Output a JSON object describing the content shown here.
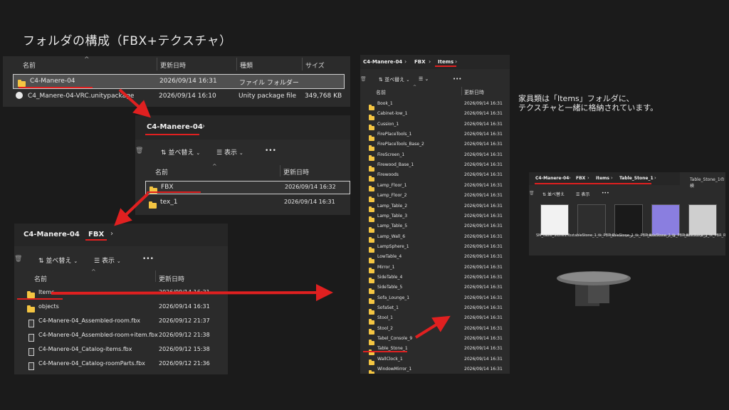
{
  "page_title": "フォルダの構成（FBX+テクスチャ）",
  "note": {
    "line1": "家具類は「Items」フォルダに、",
    "line2": "テクスチャと一緒に格納されています。"
  },
  "panel1": {
    "headers": [
      "名前",
      "更新日時",
      "種類",
      "サイズ"
    ],
    "rows": [
      {
        "name": "C4-Manere-04",
        "date": "2026/09/14 16:31",
        "type": "ファイル フォルダー",
        "size": "",
        "icon": "folder-icon"
      },
      {
        "name": "C4_Manere-04-VRC.unitypackage",
        "date": "2026/09/14 16:10",
        "type": "Unity package file",
        "size": "349,768 KB",
        "icon": "unity-icon"
      }
    ]
  },
  "panel2": {
    "breadcrumb": "C4-Manere-04",
    "sort_label": "並べ替え",
    "view_label": "表示",
    "more": "•••",
    "headers": [
      "名前",
      "更新日時"
    ],
    "rows": [
      {
        "name": "FBX",
        "date": "2026/09/14 16:32"
      },
      {
        "name": "tex_1",
        "date": "2026/09/14 16:31"
      }
    ]
  },
  "panel3": {
    "breadcrumb": [
      "C4-Manere-04",
      "FBX"
    ],
    "sort_label": "並べ替え",
    "view_label": "表示",
    "more": "•••",
    "headers": [
      "名前",
      "更新日時"
    ],
    "rows": [
      {
        "name": "Items",
        "date": "2026/09/14 16:31",
        "icon": "folder-icon"
      },
      {
        "name": "objects",
        "date": "2026/09/14 16:31",
        "icon": "folder-icon"
      },
      {
        "name": "C4-Manere-04_Assembled-room.fbx",
        "date": "2026/09/12 21:37",
        "icon": "fbx-file-icon"
      },
      {
        "name": "C4-Manere-04_Assembled-room+item.fbx",
        "date": "2026/09/12 21:38",
        "icon": "fbx-file-icon"
      },
      {
        "name": "C4-Manere-04_Catalog-items.fbx",
        "date": "2026/09/12 15:38",
        "icon": "fbx-file-icon"
      },
      {
        "name": "C4-Manere-04_Catalog-roomParts.fbx",
        "date": "2026/09/12 21:36",
        "icon": "fbx-file-icon"
      }
    ]
  },
  "panel4": {
    "breadcrumb": [
      "C4-Manere-04",
      "FBX",
      "Items"
    ],
    "sort_label": "並べ替え",
    "more": "•••",
    "headers": [
      "名前",
      "更新日時"
    ],
    "rows": [
      {
        "name": "Book_1",
        "date": "2026/09/14 16:31"
      },
      {
        "name": "Cabinet-low_1",
        "date": "2026/09/14 16:31"
      },
      {
        "name": "Cussion_1",
        "date": "2026/09/14 16:31"
      },
      {
        "name": "FirePlaceTools_1",
        "date": "2026/09/14 16:31"
      },
      {
        "name": "FirePlaceTools_Base_2",
        "date": "2026/09/14 16:31"
      },
      {
        "name": "FireScreen_1",
        "date": "2026/09/14 16:31"
      },
      {
        "name": "Firewood_Base_1",
        "date": "2026/09/14 16:31"
      },
      {
        "name": "Firewoods",
        "date": "2026/09/14 16:31"
      },
      {
        "name": "Lamp_Floor_1",
        "date": "2026/09/14 16:31"
      },
      {
        "name": "Lamp_Floor_2",
        "date": "2026/09/14 16:31"
      },
      {
        "name": "Lamp_Table_2",
        "date": "2026/09/14 16:31"
      },
      {
        "name": "Lamp_Table_3",
        "date": "2026/09/14 16:31"
      },
      {
        "name": "Lamp_Table_5",
        "date": "2026/09/14 16:31"
      },
      {
        "name": "Lamp_Wall_6",
        "date": "2026/09/14 16:31"
      },
      {
        "name": "LampSphere_1",
        "date": "2026/09/14 16:31"
      },
      {
        "name": "LowTable_4",
        "date": "2026/09/14 16:31"
      },
      {
        "name": "Mirror_1",
        "date": "2026/09/14 16:31"
      },
      {
        "name": "SideTable_4",
        "date": "2026/09/14 16:31"
      },
      {
        "name": "SideTable_5",
        "date": "2026/09/14 16:31"
      },
      {
        "name": "Sofa_Lounge_1",
        "date": "2026/09/14 16:31"
      },
      {
        "name": "SofaSet_1",
        "date": "2026/09/14 16:31"
      },
      {
        "name": "Stool_1",
        "date": "2026/09/14 16:31"
      },
      {
        "name": "Stool_2",
        "date": "2026/09/14 16:31"
      },
      {
        "name": "Tabel_Console_9",
        "date": "2026/09/14 16:31"
      },
      {
        "name": "Table_Stone_1",
        "date": "2026/09/14 16:31"
      },
      {
        "name": "WallClock_1",
        "date": "2026/09/14 16:31"
      },
      {
        "name": "WindowMirror_1",
        "date": "2026/09/14 16:31"
      }
    ]
  },
  "panel5": {
    "breadcrumb": [
      "C4-Manere-04",
      "FBX",
      "Items",
      "Table_Stone_1"
    ],
    "tab_label": "Table_Stone_1の検",
    "sort_label": "並べ替え",
    "view_label": "表示",
    "more": "•••",
    "thumbs": [
      {
        "caption": "SM_table_Stone1.fbx",
        "icon": "fbx-file-icon",
        "color": "#f2f2f2"
      },
      {
        "caption": "tableStone_1_tk_PBR_Diffuse.png",
        "icon": "diffuse-texture-icon",
        "color": "#2e2e2e"
      },
      {
        "caption": "tableStone_1_tk_PBR_Metalness.png",
        "icon": "metalness-texture-icon",
        "color": "#1a1a1a"
      },
      {
        "caption": "tableStone_1_tk_PBR_Normal.png",
        "icon": "normal-texture-icon",
        "color": "#8a7ee0"
      },
      {
        "caption": "tableStone_1_tk_PBR_Roughness.png",
        "icon": "roughness-texture-icon",
        "color": "#cfcfcf"
      }
    ]
  }
}
